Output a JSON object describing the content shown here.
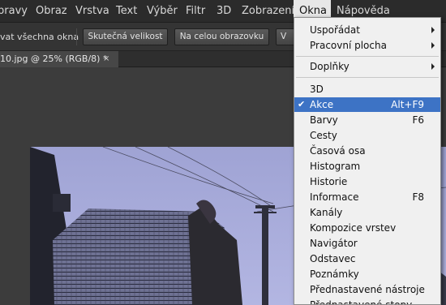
{
  "menubar": {
    "items": [
      "bravy",
      "Obraz",
      "Vrstva",
      "Text",
      "Výběr",
      "Filtr",
      "3D",
      "Zobrazení",
      "Okna",
      "Nápověda"
    ]
  },
  "options_bar": {
    "fit_all_label": "vat všechna okna",
    "actual_pixels_label": "Skutečná velikost",
    "fit_screen_label": "Na celou obrazovku",
    "fill_screen_label": "V"
  },
  "document_tab": {
    "title": "10.jpg @ 25% (RGB/8) *",
    "close_glyph": "×"
  },
  "okna_menu": {
    "group1": [
      {
        "label": "Uspořádat",
        "submenu": true
      },
      {
        "label": "Pracovní plocha",
        "submenu": true
      }
    ],
    "group2": [
      {
        "label": "Doplňky",
        "submenu": true
      }
    ],
    "group3": [
      {
        "label": "3D",
        "shortcut": ""
      },
      {
        "label": "Akce",
        "shortcut": "Alt+F9",
        "checked": true,
        "highlighted": true
      },
      {
        "label": "Barvy",
        "shortcut": "F6"
      },
      {
        "label": "Cesty",
        "shortcut": ""
      },
      {
        "label": "Časová osa",
        "shortcut": ""
      },
      {
        "label": "Histogram",
        "shortcut": ""
      },
      {
        "label": "Historie",
        "shortcut": ""
      },
      {
        "label": "Informace",
        "shortcut": "F8"
      },
      {
        "label": "Kanály",
        "shortcut": ""
      },
      {
        "label": "Kompozice vrstev",
        "shortcut": ""
      },
      {
        "label": "Navigátor",
        "shortcut": ""
      },
      {
        "label": "Odstavec",
        "shortcut": ""
      },
      {
        "label": "Poznámky",
        "shortcut": ""
      },
      {
        "label": "Přednastavené nástroje",
        "shortcut": ""
      },
      {
        "label": "Přednastavené stopy",
        "shortcut": ""
      }
    ]
  },
  "colors": {
    "menubar_bg": "#2b2b2b",
    "menu_highlight": "#3d73c5",
    "dropdown_bg": "#f0f0f0"
  }
}
